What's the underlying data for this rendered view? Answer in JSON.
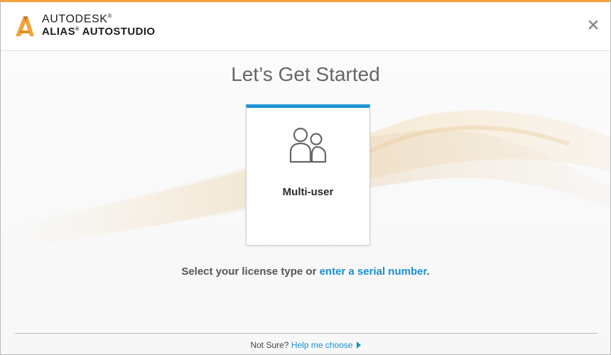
{
  "header": {
    "brand_line1": "AUTODESK",
    "brand_line1_mark": "®",
    "brand_line2": "ALIAS",
    "brand_line2_mark": "®",
    "brand_line2_rest": " AUTOSTUDIO",
    "logo_icon": "autodesk-a-icon",
    "close_icon": "close-icon"
  },
  "main": {
    "title": "Let’s Get Started",
    "cards": [
      {
        "label": "Multi-user",
        "icon": "multi-user-icon",
        "accent": "#1a94d6"
      }
    ],
    "prompt_text": "Select your license type or ",
    "prompt_link": "enter a serial number",
    "prompt_end": "."
  },
  "footer": {
    "not_sure": "Not Sure? ",
    "help_link": "Help me choose",
    "arrow_icon": "caret-right-icon"
  },
  "colors": {
    "accent_orange": "#f3a33a",
    "link_blue": "#1a8fd0",
    "card_accent": "#1a94d6"
  }
}
